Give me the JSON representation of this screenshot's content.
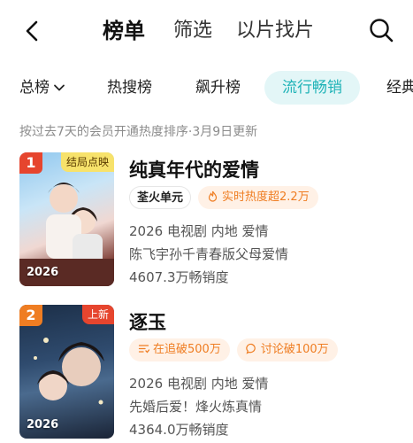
{
  "header": {
    "tabs": [
      "榜单",
      "筛选",
      "以片找片"
    ]
  },
  "categories": {
    "dropdown_label": "总榜",
    "items": [
      "热搜榜",
      "飙升榜",
      "流行畅销",
      "经典"
    ],
    "active_index": 2
  },
  "subtitle": "按过去7天的会员开通热度排序·3月9日更新",
  "colors": {
    "accent": "#1fb3b7",
    "rank": "#e6452e",
    "badge": "#ef7d22"
  },
  "list": [
    {
      "rank": "1",
      "tag": "结局点映",
      "year": "2026",
      "title": "纯真年代的爱情",
      "badges": [
        "荃火单元",
        "实时热度超2.2万"
      ],
      "meta": "2026 电视剧 内地 爱情",
      "desc": "陈飞宇孙千青春版父母爱情",
      "sales": "4607.3万畅销度"
    },
    {
      "rank": "2",
      "tag": "上新",
      "year": "2026",
      "title": "逐玉",
      "badges": [
        "在追破500万",
        "讨论破100万"
      ],
      "meta": "2026 电视剧 内地 爱情",
      "desc": "先婚后爱！烽火炼真情",
      "sales": "4364.0万畅销度"
    }
  ]
}
